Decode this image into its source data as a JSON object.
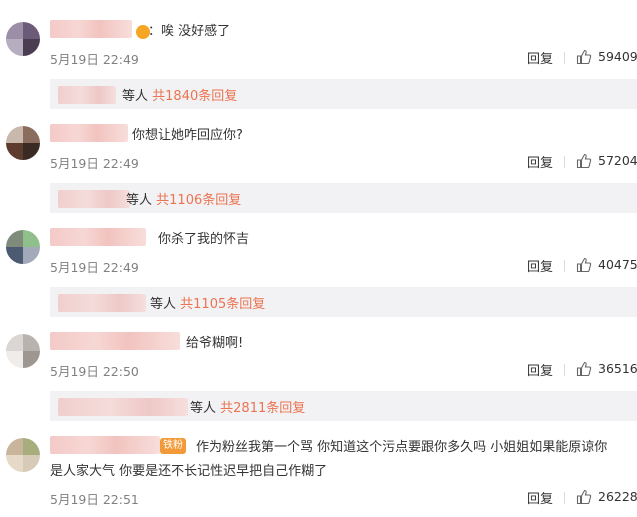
{
  "comments": [
    {
      "text": "：唉 没好感了",
      "time": "5月19日 22:49",
      "reply": "回复",
      "likes": "59409",
      "thread": {
        "suffix": "等人",
        "count": "共1840条回复"
      }
    },
    {
      "text": "你想让她咋回应你?",
      "time": "5月19日 22:49",
      "reply": "回复",
      "likes": "57204",
      "thread": {
        "suffix": "等人",
        "count": "共1106条回复"
      }
    },
    {
      "text": "你杀了我的怀吉",
      "time": "5月19日 22:49",
      "reply": "回复",
      "likes": "40475",
      "thread": {
        "suffix": "等人",
        "count": "共1105条回复"
      }
    },
    {
      "text": "给爷糊啊!",
      "time": "5月19日 22:50",
      "reply": "回复",
      "likes": "36516",
      "thread": {
        "suffix": "等人",
        "count": "共2811条回复"
      }
    },
    {
      "text": "作为粉丝我第一个骂 你知道这个污点要跟你多久吗 小姐姐如果能原谅你",
      "text2": "是人家大气 你要是还不长记性迟早把自己作糊了",
      "badge": "铁粉",
      "time": "5月19日 22:51",
      "reply": "回复",
      "likes": "26228"
    }
  ],
  "colors": {
    "accent": "#eb7350",
    "muted": "#808080",
    "reply_bg": "#f2f2f5"
  }
}
